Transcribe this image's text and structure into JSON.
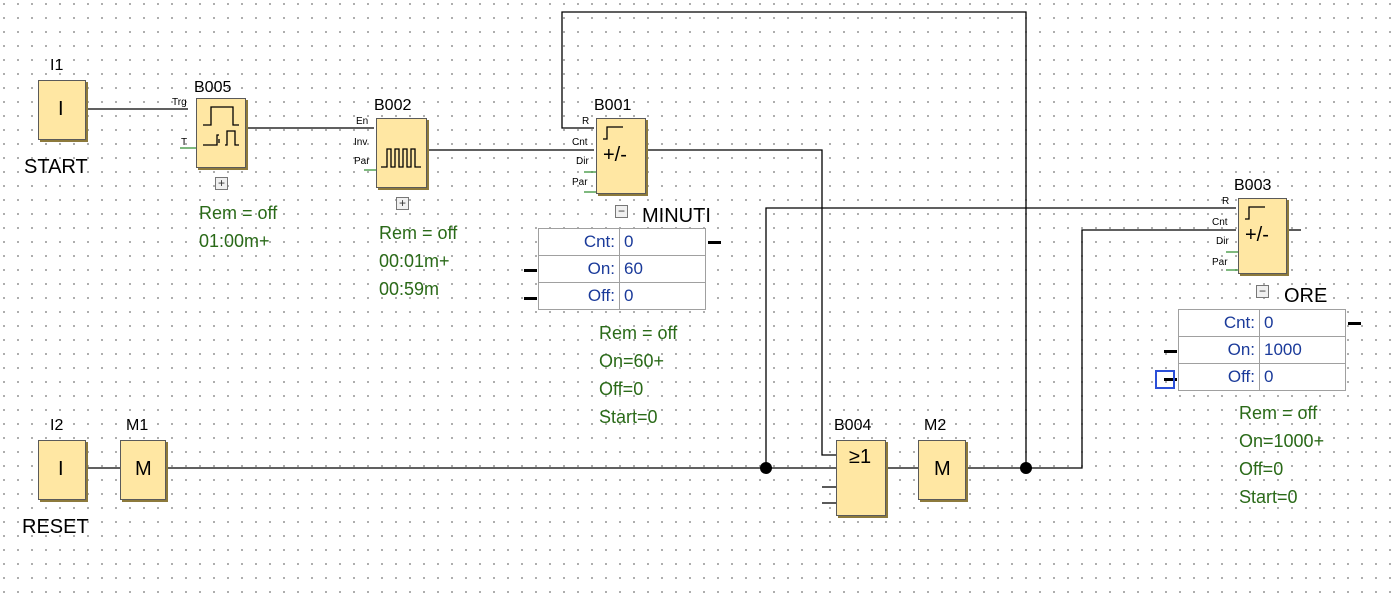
{
  "inputs": {
    "i1": {
      "id": "I1",
      "symbol": "I",
      "name": "START"
    },
    "i2": {
      "id": "I2",
      "symbol": "I",
      "name": "RESET"
    }
  },
  "flags": {
    "m1": {
      "id": "M1",
      "symbol": "M"
    },
    "m2": {
      "id": "M2",
      "symbol": "M"
    }
  },
  "b005": {
    "id": "B005",
    "pins": [
      "Trg",
      "T"
    ],
    "params": [
      "Rem = off",
      "01:00m+"
    ]
  },
  "b002": {
    "id": "B002",
    "pins": [
      "En",
      "Inv",
      "Par"
    ],
    "params": [
      "Rem = off",
      "00:01m+",
      "00:59m"
    ]
  },
  "b001": {
    "id": "B001",
    "pins": [
      "R",
      "Cnt",
      "Dir",
      "Par"
    ],
    "symbol": "+/-",
    "name": "MINUTI",
    "table": [
      {
        "key": "Cnt:",
        "value": "0"
      },
      {
        "key": "On:",
        "value": "60"
      },
      {
        "key": "Off:",
        "value": "0"
      }
    ],
    "params": [
      "Rem = off",
      "On=60+",
      "Off=0",
      "Start=0"
    ]
  },
  "b003": {
    "id": "B003",
    "pins": [
      "R",
      "Cnt",
      "Dir",
      "Par"
    ],
    "symbol": "+/-",
    "name": "ORE",
    "table": [
      {
        "key": "Cnt:",
        "value": "0"
      },
      {
        "key": "On:",
        "value": "1000"
      },
      {
        "key": "Off:",
        "value": "0"
      }
    ],
    "params": [
      "Rem = off",
      "On=1000+",
      "Off=0",
      "Start=0"
    ]
  },
  "b004": {
    "id": "B004",
    "symbol": "≥1"
  },
  "ui": {
    "expand": "+",
    "collapse": "−"
  },
  "colors": {
    "block_fill": "#ffe7a3",
    "param_text": "#2a6a18",
    "table_value": "#1a3a9a"
  }
}
